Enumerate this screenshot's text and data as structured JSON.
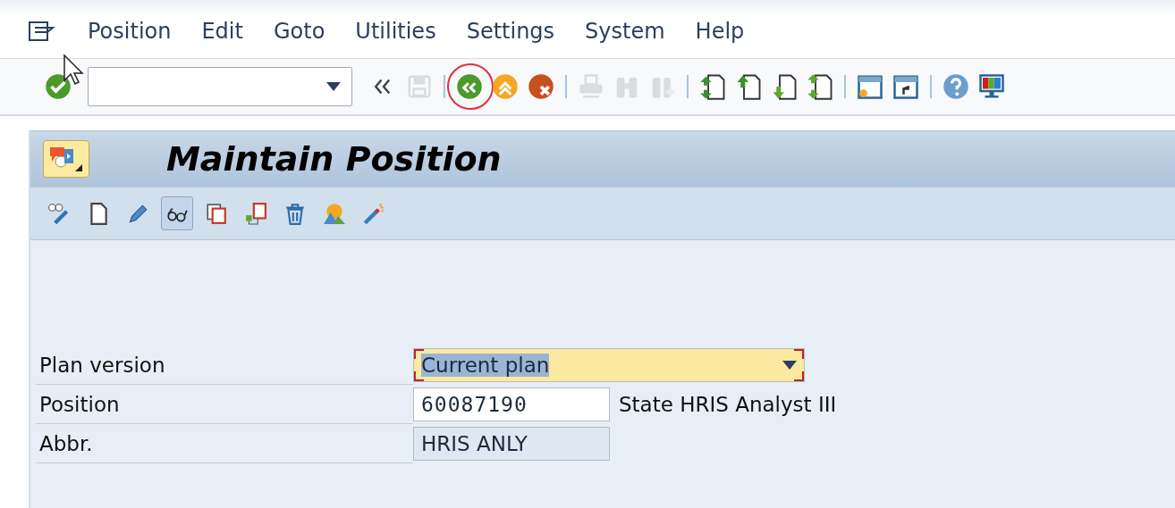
{
  "menu": [
    {
      "label": "Position"
    },
    {
      "label": "Edit"
    },
    {
      "label": "Goto"
    },
    {
      "label": "Utilities"
    },
    {
      "label": "Settings"
    },
    {
      "label": "System"
    },
    {
      "label": "Help"
    }
  ],
  "toolbar_groups": [
    [
      {
        "kind": "enter",
        "disabled": false,
        "highlighted": false
      }
    ],
    [
      {
        "kind": "collapse",
        "disabled": false,
        "highlighted": false
      },
      {
        "kind": "save",
        "disabled": true,
        "highlighted": false
      }
    ],
    [
      {
        "kind": "back",
        "disabled": false,
        "highlighted": true
      },
      {
        "kind": "exit",
        "disabled": false,
        "highlighted": false
      },
      {
        "kind": "cancel",
        "disabled": false,
        "highlighted": false
      }
    ],
    [
      {
        "kind": "print",
        "disabled": true,
        "highlighted": false
      },
      {
        "kind": "find",
        "disabled": true,
        "highlighted": false
      },
      {
        "kind": "find-next",
        "disabled": true,
        "highlighted": false
      }
    ],
    [
      {
        "kind": "first-page",
        "disabled": false,
        "highlighted": false
      },
      {
        "kind": "prev-page",
        "disabled": false,
        "highlighted": false
      },
      {
        "kind": "next-page",
        "disabled": false,
        "highlighted": false
      },
      {
        "kind": "last-page",
        "disabled": false,
        "highlighted": false
      }
    ],
    [
      {
        "kind": "new-session",
        "disabled": false,
        "highlighted": false
      },
      {
        "kind": "shortcut",
        "disabled": false,
        "highlighted": false
      }
    ],
    [
      {
        "kind": "help",
        "disabled": false,
        "highlighted": false
      },
      {
        "kind": "layout",
        "disabled": false,
        "highlighted": false
      }
    ]
  ],
  "screen": {
    "title": "Maintain Position",
    "app_toolbar": [
      {
        "kind": "overview",
        "selected": false
      },
      {
        "kind": "create",
        "selected": false
      },
      {
        "kind": "change",
        "selected": false
      },
      {
        "kind": "display",
        "selected": true
      },
      {
        "kind": "copy",
        "selected": false
      },
      {
        "kind": "delimit",
        "selected": false
      },
      {
        "kind": "delete",
        "selected": false
      },
      {
        "kind": "image",
        "selected": false
      },
      {
        "kind": "wizard",
        "selected": false
      }
    ],
    "fields": [
      {
        "label": "Plan version",
        "kind": "dropdown",
        "value": "Current plan",
        "required": true,
        "text_selected": true
      },
      {
        "label": "Position",
        "kind": "input",
        "value": "60087190",
        "description": "State HRIS Analyst III",
        "required": false,
        "text_selected": false
      },
      {
        "label": "Abbr.",
        "kind": "readonly",
        "value": "HRIS ANLY",
        "required": false,
        "text_selected": false
      }
    ]
  }
}
